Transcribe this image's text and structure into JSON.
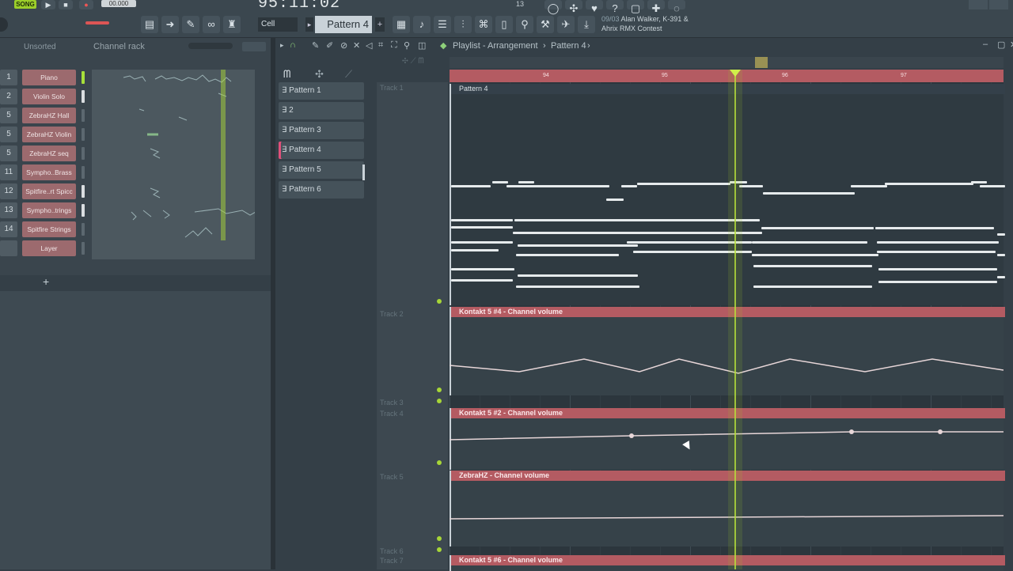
{
  "toolbar": {
    "song_mode": "SONG",
    "tempo": "00.000",
    "time": "95:11:02",
    "snap": "Cell",
    "pattern": "Pattern 4",
    "hint_count": "13",
    "hint_date": "09/03",
    "hint_text": "Alan Walker, K-391 & Ahrix RMX Contest"
  },
  "rack": {
    "filter": "Unsorted",
    "title": "Channel rack",
    "channels": [
      {
        "num": "1",
        "name": "Piano"
      },
      {
        "num": "2",
        "name": "Violin Solo"
      },
      {
        "num": "5",
        "name": "ZebraHZ Hall"
      },
      {
        "num": "5",
        "name": "ZebraHZ Violin"
      },
      {
        "num": "5",
        "name": "ZebraHZ seq"
      },
      {
        "num": "11",
        "name": "Sympho..Brass"
      },
      {
        "num": "12",
        "name": "Spitfire..rt Spicc"
      },
      {
        "num": "13",
        "name": "Sympho..trings"
      },
      {
        "num": "14",
        "name": "Spitfire Strings"
      },
      {
        "num": "",
        "name": "Layer"
      }
    ],
    "add_label": "+"
  },
  "playlist": {
    "title": "Playlist - Arrangement",
    "current_pattern": "Pattern 4",
    "patterns": [
      "Pattern 1",
      "2",
      "Pattern 3",
      "Pattern 4",
      "Pattern 5",
      "Pattern 6"
    ],
    "tracks": [
      {
        "label": "Track 1"
      },
      {
        "label": "Track 2"
      },
      {
        "label": "Track 3"
      },
      {
        "label": "Track 4"
      },
      {
        "label": "Track 5"
      },
      {
        "label": "Track 6"
      },
      {
        "label": "Track 7"
      }
    ],
    "ruler": [
      "94",
      "95",
      "96",
      "97"
    ],
    "clips": [
      {
        "name": "Pattern 4"
      },
      {
        "name": "Kontakt 5 #4 - Channel volume"
      },
      {
        "name": "Kontakt 5 #2 - Channel volume"
      },
      {
        "name": "ZebraHZ - Channel volume"
      },
      {
        "name": "Kontakt 5 #6 - Channel volume"
      }
    ]
  },
  "colors": {
    "accent": "#9ccf2a",
    "clip_header": "#b45b62",
    "pattern_clip": "#4d5960"
  }
}
